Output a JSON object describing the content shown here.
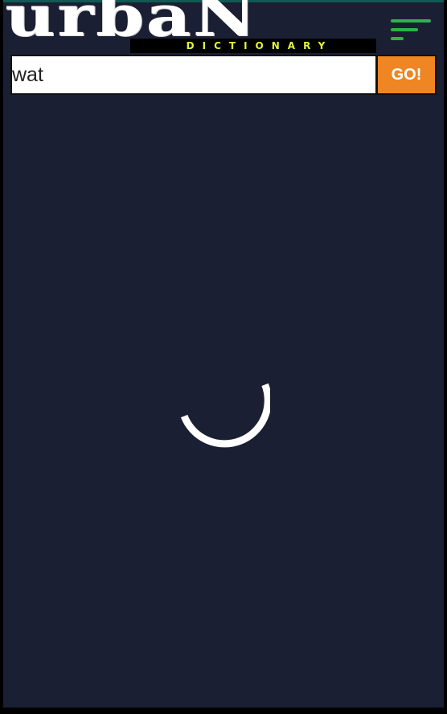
{
  "header": {
    "logo_word": "urbaN",
    "logo_subtitle": "DICTIONARY",
    "menu_icon": "hamburger-menu-icon"
  },
  "search": {
    "value": "wat",
    "placeholder": "",
    "go_label": "GO!"
  },
  "status": {
    "loading_indicator": "spinner-icon"
  },
  "colors": {
    "background": "#1b1f33",
    "go_button": "#ef8623",
    "menu_icon": "#2fb24a",
    "logo_subtitle": "#e3f53a"
  }
}
